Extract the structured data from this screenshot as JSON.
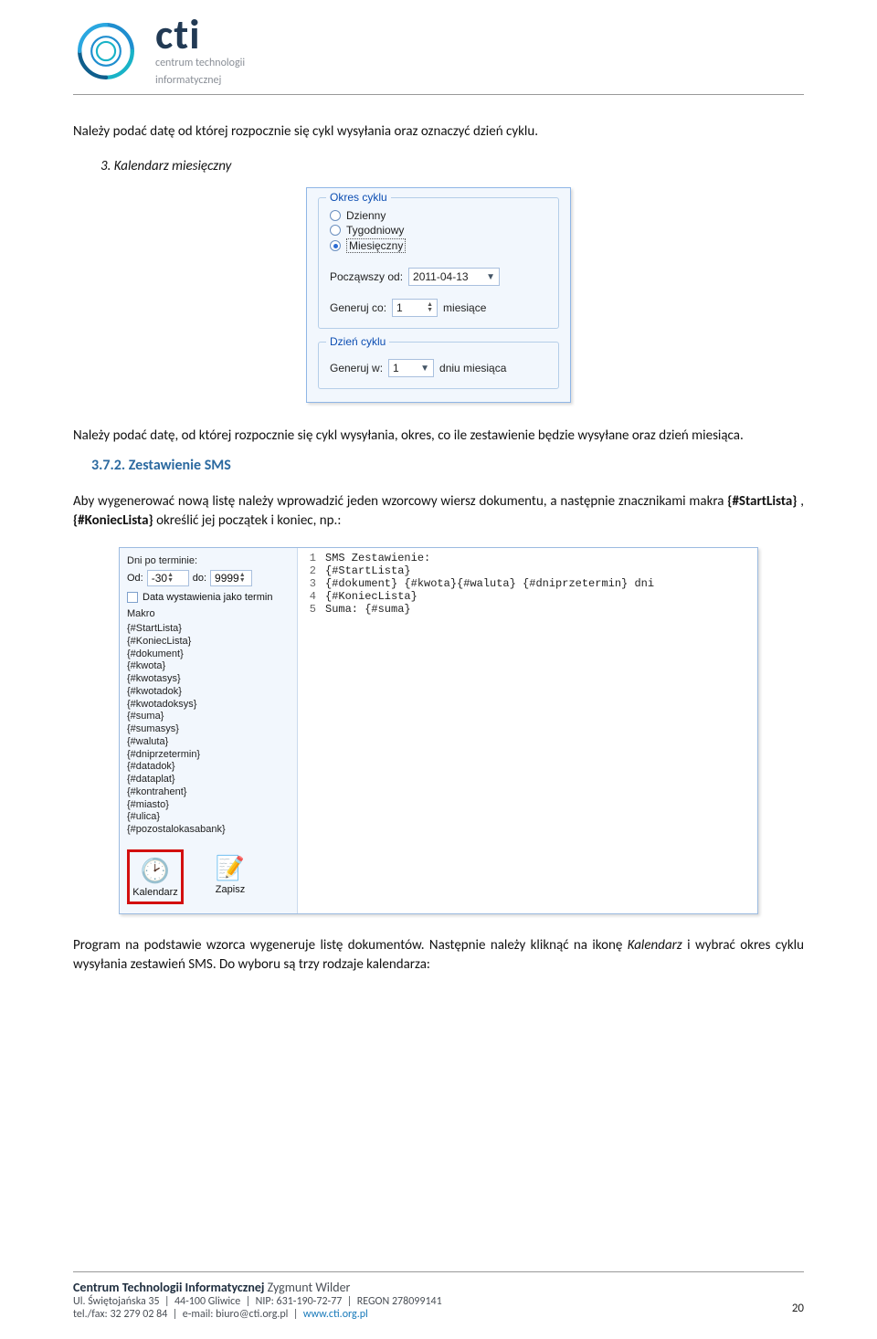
{
  "header": {
    "brand_mark": "cti",
    "brand_sub_1": "centrum technologii",
    "brand_sub_2": "informatycznej"
  },
  "intro_text": "Należy podać datę od której rozpocznie się cykl wysyłania oraz oznaczyć dzień cyklu.",
  "step3_label": "3.  Kalendarz miesięczny",
  "panel": {
    "okres_title": "Okres cyklu",
    "opt_dzienny": "Dzienny",
    "opt_tygodniowy": "Tygodniowy",
    "opt_miesieczny": "Miesięczny",
    "poczawszy_label": "Począwszy od:",
    "poczawszy_value": "2011-04-13",
    "generuj_co_label": "Generuj co:",
    "generuj_co_value": "1",
    "generuj_co_unit": "miesiące",
    "dzien_title": "Dzień cyklu",
    "generuj_w_label": "Generuj w:",
    "generuj_w_value": "1",
    "generuj_w_unit": "dniu miesiąca"
  },
  "after_panel_text": "Należy podać datę, od której rozpocznie się cykl wysyłania, okres, co ile zestawienie będzie wysyłane oraz dzień miesiąca.",
  "section_heading": "3.7.2. Zestawienie SMS",
  "section_body_pre": "Aby wygenerować nową listę należy wprowadzić jeden wzorcowy wiersz dokumentu, a następnie znacznikami makra ",
  "macro_start": "{#StartLista}",
  "macro_sep": ", ",
  "macro_end": "{#KoniecLista}",
  "section_body_post": " określić jej początek i koniec, np.:",
  "scr2": {
    "dni_po_terminie": "Dni po terminie:",
    "od_label": "Od:",
    "od_value": "-30",
    "do_label": "do:",
    "do_value": "9999",
    "chk_label": "Data wystawienia jako termin",
    "makro_label": "Makro",
    "macros": [
      "{#StartLista}",
      "{#KoniecLista}",
      "{#dokument}",
      "{#kwota}",
      "{#kwotasys}",
      "{#kwotadok}",
      "{#kwotadoksys}",
      "{#suma}",
      "{#sumasys}",
      "{#waluta}",
      "{#dniprzetermin}",
      "{#datadok}",
      "{#dataplat}",
      "{#kontrahent}",
      "{#miasto}",
      "{#ulica}",
      "{#pozostalokasabank}"
    ],
    "btn_kalendarz": "Kalendarz",
    "btn_zapisz": "Zapisz",
    "code_lines": [
      "SMS Zestawienie:",
      "{#StartLista}",
      "{#dokument} {#kwota}{#waluta} {#dniprzetermin} dni",
      "{#KoniecLista}",
      "Suma: {#suma}"
    ]
  },
  "closing_text_1": "Program na podstawie wzorca wygeneruje listę dokumentów. Następnie należy kliknąć na ikonę ",
  "closing_em": "Kalendarz",
  "closing_text_2": " i wybrać okres cyklu wysyłania zestawień SMS. Do wyboru są trzy rodzaje kalendarza:",
  "footer": {
    "line1_bold": "Centrum Technologii Informatycznej",
    "line1_rest": " Zygmunt Wilder",
    "line2_a": "Ul. Świętojańska 35",
    "line2_b": "44-100 Gliwice",
    "line2_c": "NIP: 631-190-72-77",
    "line2_d": "REGON 278099141",
    "line3_a": "tel./fax: 32 279 02 84",
    "line3_b": "e-mail: biuro@cti.org.pl",
    "line3_c": "www.cti.org.pl"
  },
  "page_number": "20"
}
